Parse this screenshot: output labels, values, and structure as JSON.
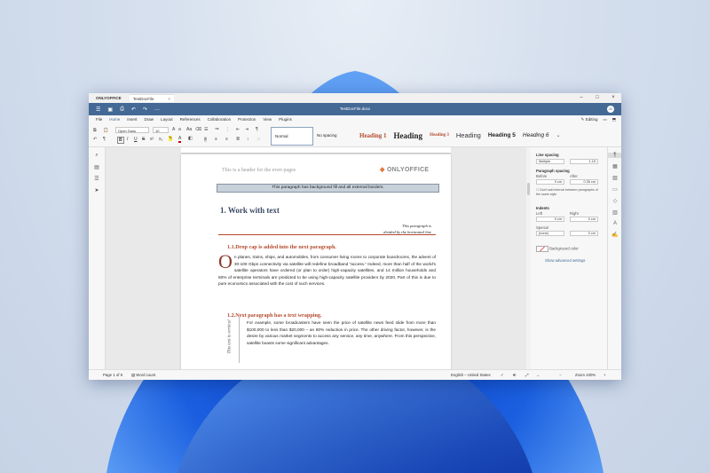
{
  "window": {
    "app_tab": "ONLYOFFICE",
    "doc_tab": "TestDocFile",
    "doc_title": "TestDocFile.docx",
    "avatar": "JD"
  },
  "menu": [
    "File",
    "Home",
    "Insert",
    "Draw",
    "Layout",
    "References",
    "Collaboration",
    "Protection",
    "View",
    "Plugins"
  ],
  "menu_active": "Home",
  "menu_right": {
    "editing": "Editing"
  },
  "toolbar": {
    "font_name": "Open Sans",
    "font_size": "10",
    "styles": [
      "Normal",
      "No spacing",
      "Heading 1",
      "Heading",
      "Heading 3",
      "Heading",
      "Heading 5",
      "Heading 6"
    ]
  },
  "document": {
    "header_text": "This is a header for the even pages",
    "logo_text": "ONLYOFFICE",
    "bg_paragraph": "This paragraph has background fill and all external borders.",
    "h1": "1.   Work with text",
    "right_line1": "This paragraph is",
    "right_line2": "divided by the horizontal line",
    "h2_a": "1.1.Drop cap is added into the next paragraph.",
    "dropcap": "O",
    "para_a": "n planes, trains, ships, and automobiles, from consumer living rooms to corporate boardrooms, the advent of 30-100 Gbps connectivity via satellite will redefine broadband “access.” Indeed, more than half of the world’s satellite operators have ordered (or plan to order) high-capacity satellites, and 14 million households and 50% of enterprise terminals are predicted to be using high-capacity satellite providers by 2020. Part of this is due to pure economics associated with the cost of such services.",
    "h2_b": "1.2.Next paragraph has a text wrapping.",
    "vertical_text": "This text is vertical",
    "para_b": "For example, some broadcasters have seen the price of satellite news feed slide from more than $100,000 to less than $20,000 – an 80% reduction in price. The other driving factor, however, is the desire by various market segments to access any service, any time, anywhere. From this perspective, satellite boasts some significant advantages."
  },
  "panel": {
    "line_spacing": "Line spacing",
    "line_spacing_type": "Multiple",
    "line_spacing_value": "1.15",
    "para_spacing": "Paragraph spacing",
    "before": "Before",
    "after": "After",
    "before_value": "0 cm",
    "after_value": "0.35 cm",
    "dont_add": "Don't add interval between paragraphs of the same style",
    "indents": "Indents",
    "left": "Left",
    "right": "Right",
    "left_value": "0 cm",
    "right_value": "0 cm",
    "special": "Special",
    "special_value": "(none)",
    "special_num": "0 cm",
    "bg_color": "Background color",
    "advanced": "Show advanced settings"
  },
  "status": {
    "page": "Page 1 of 9",
    "word_count": "Word count",
    "language": "English – United States",
    "zoom": "Zoom 100%"
  }
}
